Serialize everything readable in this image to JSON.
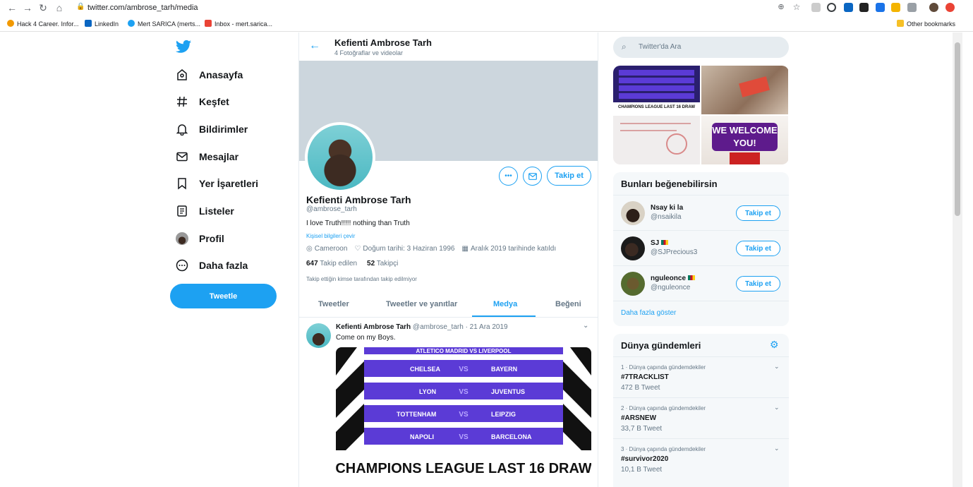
{
  "browser": {
    "url": "twitter.com/ambrose_tarh/media",
    "bookmarks": [
      "Hack 4 Career. Infor...",
      "LinkedIn",
      "Mert SARICA (merts...",
      "Inbox - mert.sarica..."
    ],
    "other_bookmarks": "Other bookmarks"
  },
  "nav": {
    "items": [
      {
        "label": "Anasayfa",
        "icon": "home-icon"
      },
      {
        "label": "Keşfet",
        "icon": "hash-icon"
      },
      {
        "label": "Bildirimler",
        "icon": "bell-icon"
      },
      {
        "label": "Mesajlar",
        "icon": "mail-icon"
      },
      {
        "label": "Yer İşaretleri",
        "icon": "bookmark-icon"
      },
      {
        "label": "Listeler",
        "icon": "list-icon"
      },
      {
        "label": "Profil",
        "icon": "profile-avatar-icon"
      },
      {
        "label": "Daha fazla",
        "icon": "more-circle-icon"
      }
    ],
    "tweet_button": "Tweetle"
  },
  "header": {
    "name": "Kefienti Ambrose Tarh",
    "subtitle": "4 Fotoğraflar ve videolar"
  },
  "profile": {
    "name": "Kefienti Ambrose Tarh",
    "handle": "@ambrose_tarh",
    "bio": "I love Truth!!!!!  nothing than Truth",
    "personal_link": "Kişisel bilgileri çevir",
    "location": "Cameroon",
    "birthday": "Doğum tarihi: 3 Haziran 1996",
    "joined": "Aralık 2019 tarihinde katıldı",
    "following_count": "647",
    "following_label": "Takip edilen",
    "followers_count": "52",
    "followers_label": "Takipçi",
    "not_followed": "Takip ettiğin kimse tarafından takip edilmiyor",
    "follow_button": "Takip et"
  },
  "tabs": [
    "Tweetler",
    "Tweetler ve yanıtlar",
    "Medya",
    "Beğeni"
  ],
  "active_tab": "Medya",
  "tweet": {
    "name": "Kefienti Ambrose Tarh",
    "handle": "@ambrose_tarh",
    "date": "· 21 Ara 2019",
    "text": "Come on my Boys.",
    "image": {
      "top_row": "ATLETICO MADRID   VS   LIVERPOOL",
      "rows": [
        {
          "home": "CHELSEA",
          "vs": "VS",
          "away": "BAYERN"
        },
        {
          "home": "LYON",
          "vs": "VS",
          "away": "JUVENTUS"
        },
        {
          "home": "TOTTENHAM",
          "vs": "VS",
          "away": "LEIPZIG"
        },
        {
          "home": "NAPOLI",
          "vs": "VS",
          "away": "BARCELONA"
        }
      ],
      "caption": "CHAMPIONS LEAGUE LAST 16 DRAW"
    }
  },
  "search": {
    "placeholder": "Twitter'da Ara"
  },
  "thumbs": {
    "thumb1_caption": "CHAMPIONS LEAGUE LAST 16 DRAW",
    "thumb4_text": "WE WELCOME YOU!"
  },
  "suggestions": {
    "title": "Bunları beğenebilirsin",
    "users": [
      {
        "name": "Nsay ki la",
        "handle": "@nsaikila",
        "button": "Takip et"
      },
      {
        "name": "SJ",
        "handle": "@SJPrecious3",
        "button": "Takip et"
      },
      {
        "name": "nguleonce",
        "handle": "@nguleonce",
        "button": "Takip et"
      }
    ],
    "more": "Daha fazla göster"
  },
  "trends": {
    "title": "Dünya gündemleri",
    "items": [
      {
        "context": "1 · Dünya çapında gündemdekiler",
        "tag": "#7TRACKLIST",
        "count": "472 B Tweet"
      },
      {
        "context": "2 · Dünya çapında gündemdekiler",
        "tag": "#ARSNEW",
        "count": "33,7 B Tweet"
      },
      {
        "context": "3 · Dünya çapında gündemdekiler",
        "tag": "#survivor2020",
        "count": "10,1 B Tweet"
      }
    ]
  },
  "colors": {
    "accent": "#1da1f2",
    "muted": "#657786",
    "panel": "#f5f8fa",
    "border": "#e6ecf0"
  }
}
